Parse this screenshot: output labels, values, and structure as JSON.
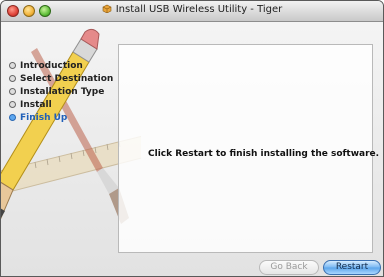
{
  "window": {
    "title": "Install USB Wireless Utility - Tiger"
  },
  "sidebar": {
    "steps": [
      {
        "label": "Introduction",
        "active": false
      },
      {
        "label": "Select Destination",
        "active": false
      },
      {
        "label": "Installation Type",
        "active": false
      },
      {
        "label": "Install",
        "active": false
      },
      {
        "label": "Finish Up",
        "active": true
      }
    ]
  },
  "main": {
    "message": "Click Restart to finish installing the software."
  },
  "buttons": {
    "back_label": "Go Back",
    "restart_label": "Restart"
  },
  "colors": {
    "active_step": "#1f5fb8",
    "default_button": "#78b7f2"
  },
  "icons": {
    "title": "package-icon",
    "art": "pencil-ruler-brush-icon"
  }
}
